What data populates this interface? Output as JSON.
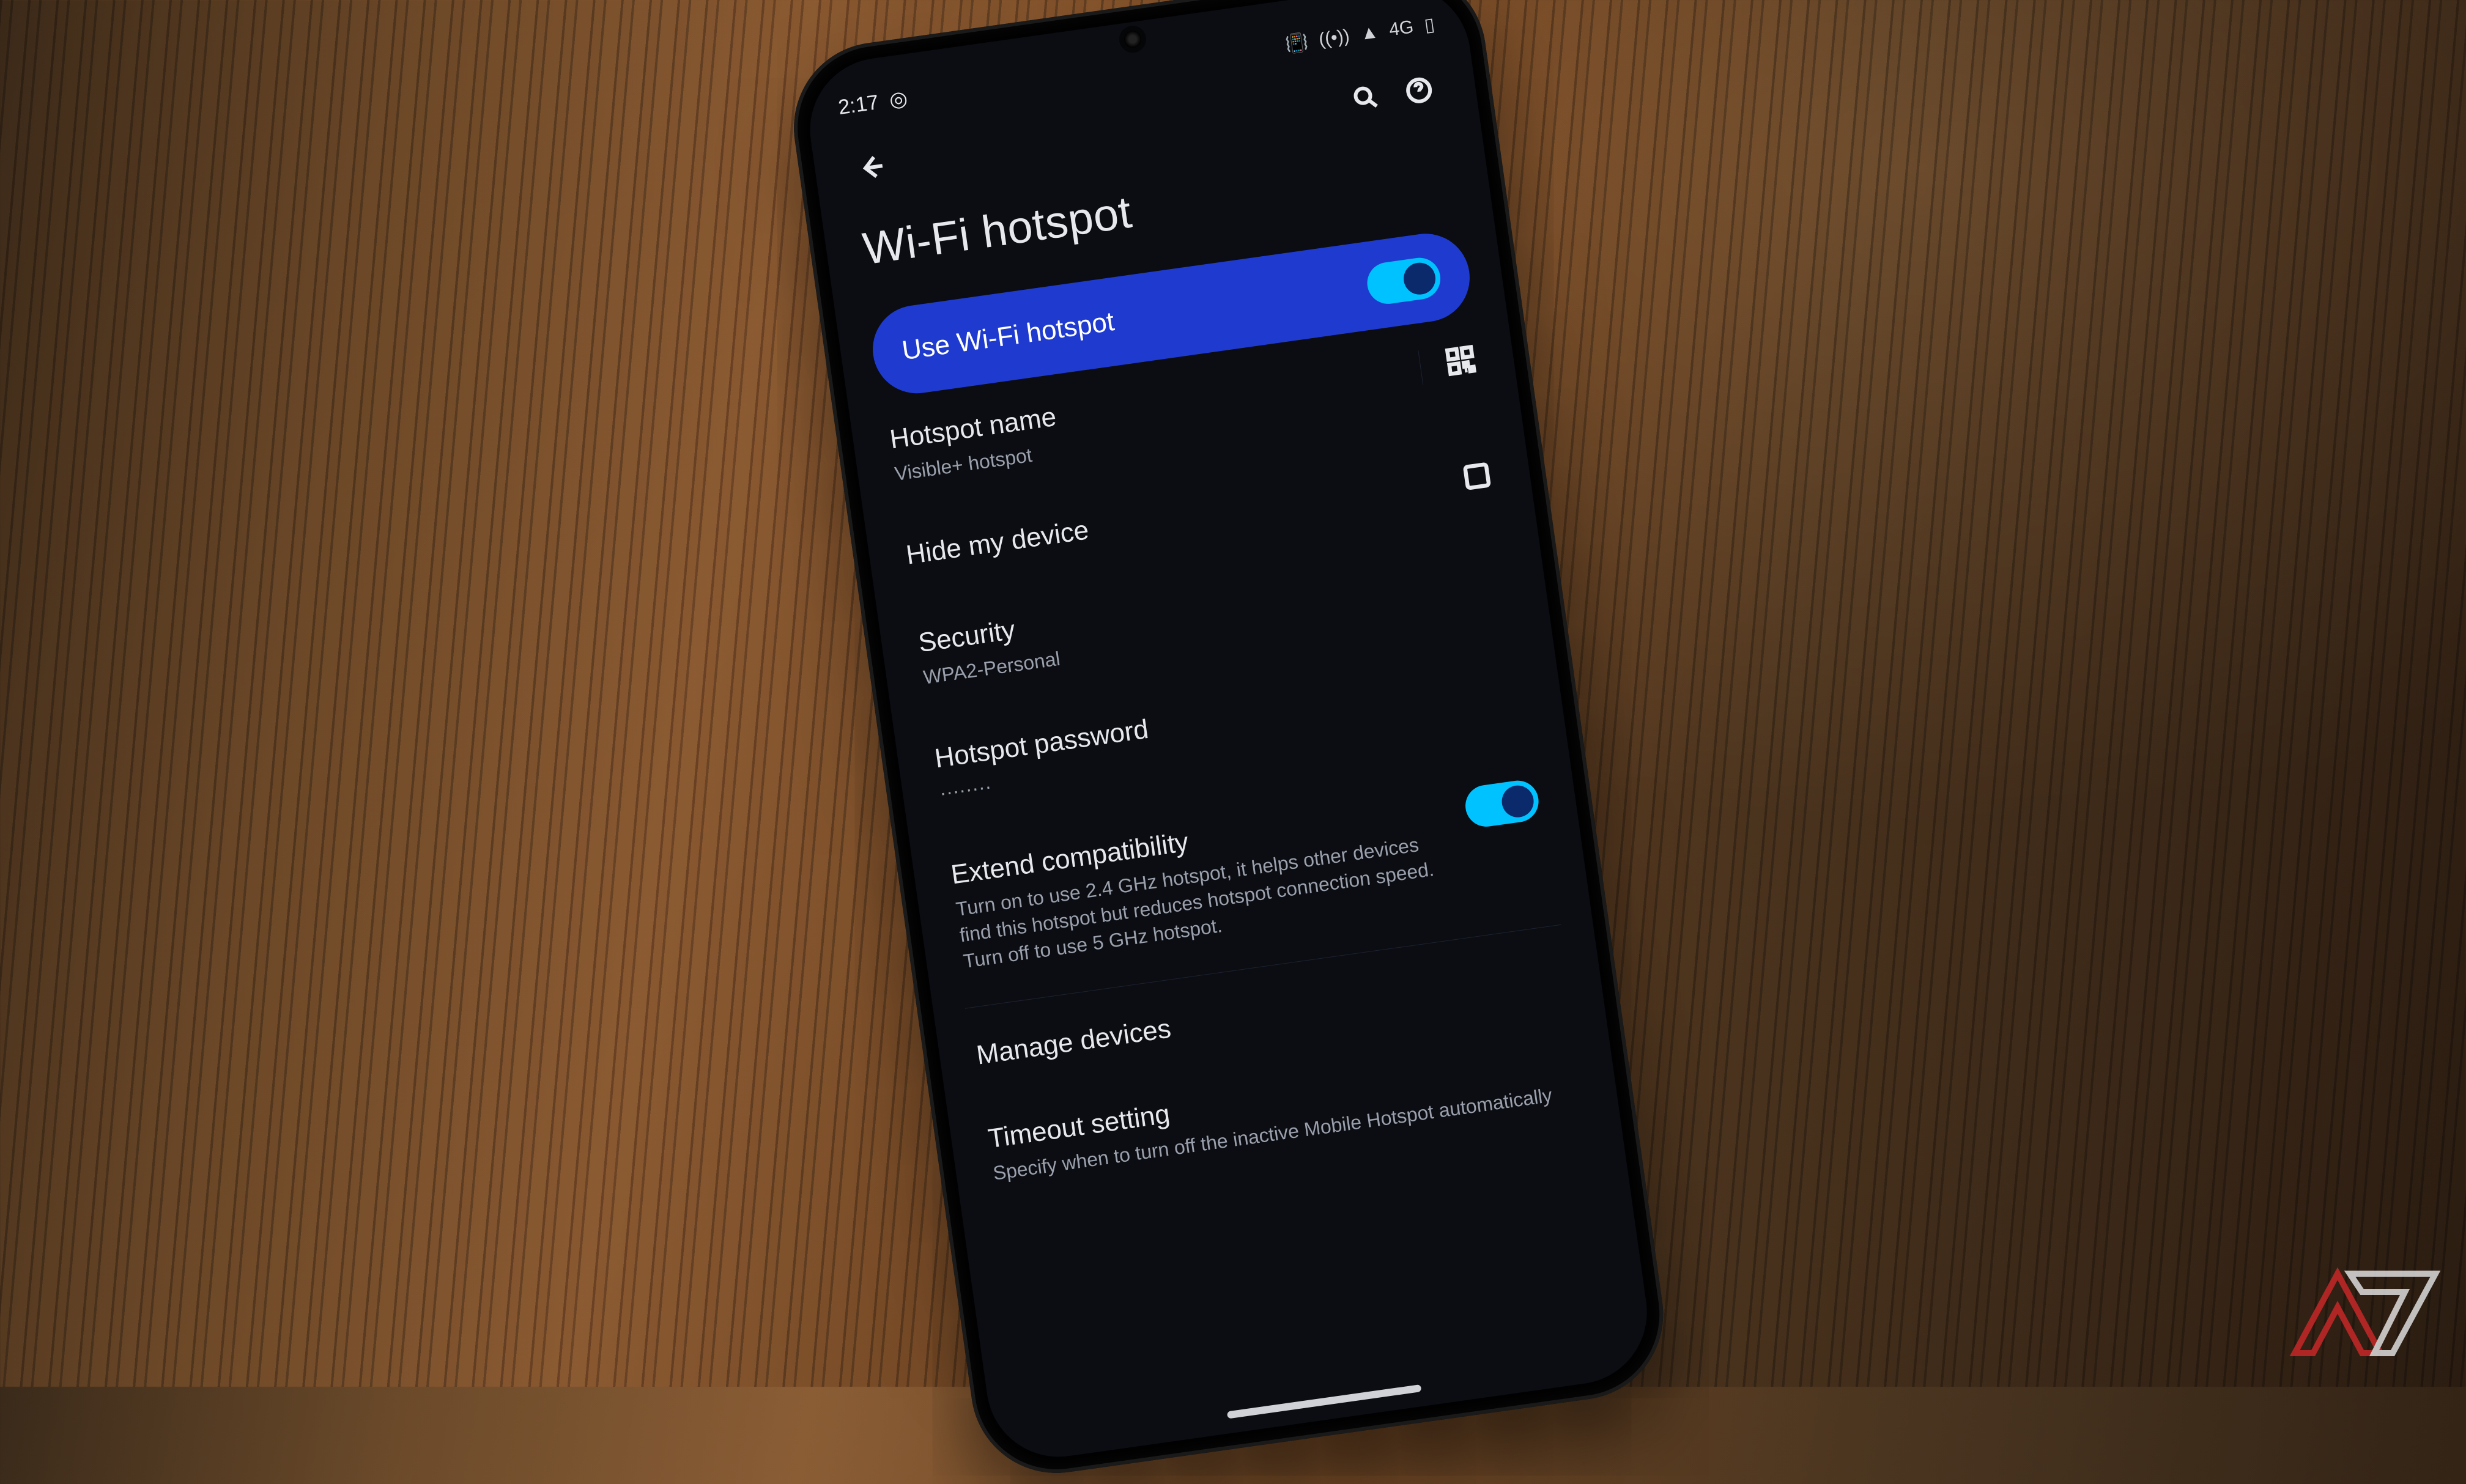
{
  "status": {
    "time": "2:17",
    "net_label": "4G",
    "signal_icon": "▲"
  },
  "page": {
    "title": "Wi-Fi hotspot"
  },
  "master": {
    "label": "Use Wi-Fi hotspot",
    "enabled": true
  },
  "rows": {
    "name": {
      "title": "Hotspot name",
      "value": "Visible+ hotspot"
    },
    "hide": {
      "title": "Hide my device"
    },
    "security": {
      "title": "Security",
      "value": "WPA2-Personal"
    },
    "password": {
      "title": "Hotspot password",
      "value": "········"
    },
    "extend": {
      "title": "Extend compatibility",
      "desc": "Turn on to use 2.4 GHz hotspot, it helps other devices find this hotspot but reduces hotspot connection speed. Turn off to use 5 GHz hotspot.",
      "enabled": true
    },
    "manage": {
      "title": "Manage devices"
    },
    "timeout": {
      "title": "Timeout setting",
      "desc": "Specify when to turn off the inactive Mobile Hotspot automatically"
    }
  }
}
